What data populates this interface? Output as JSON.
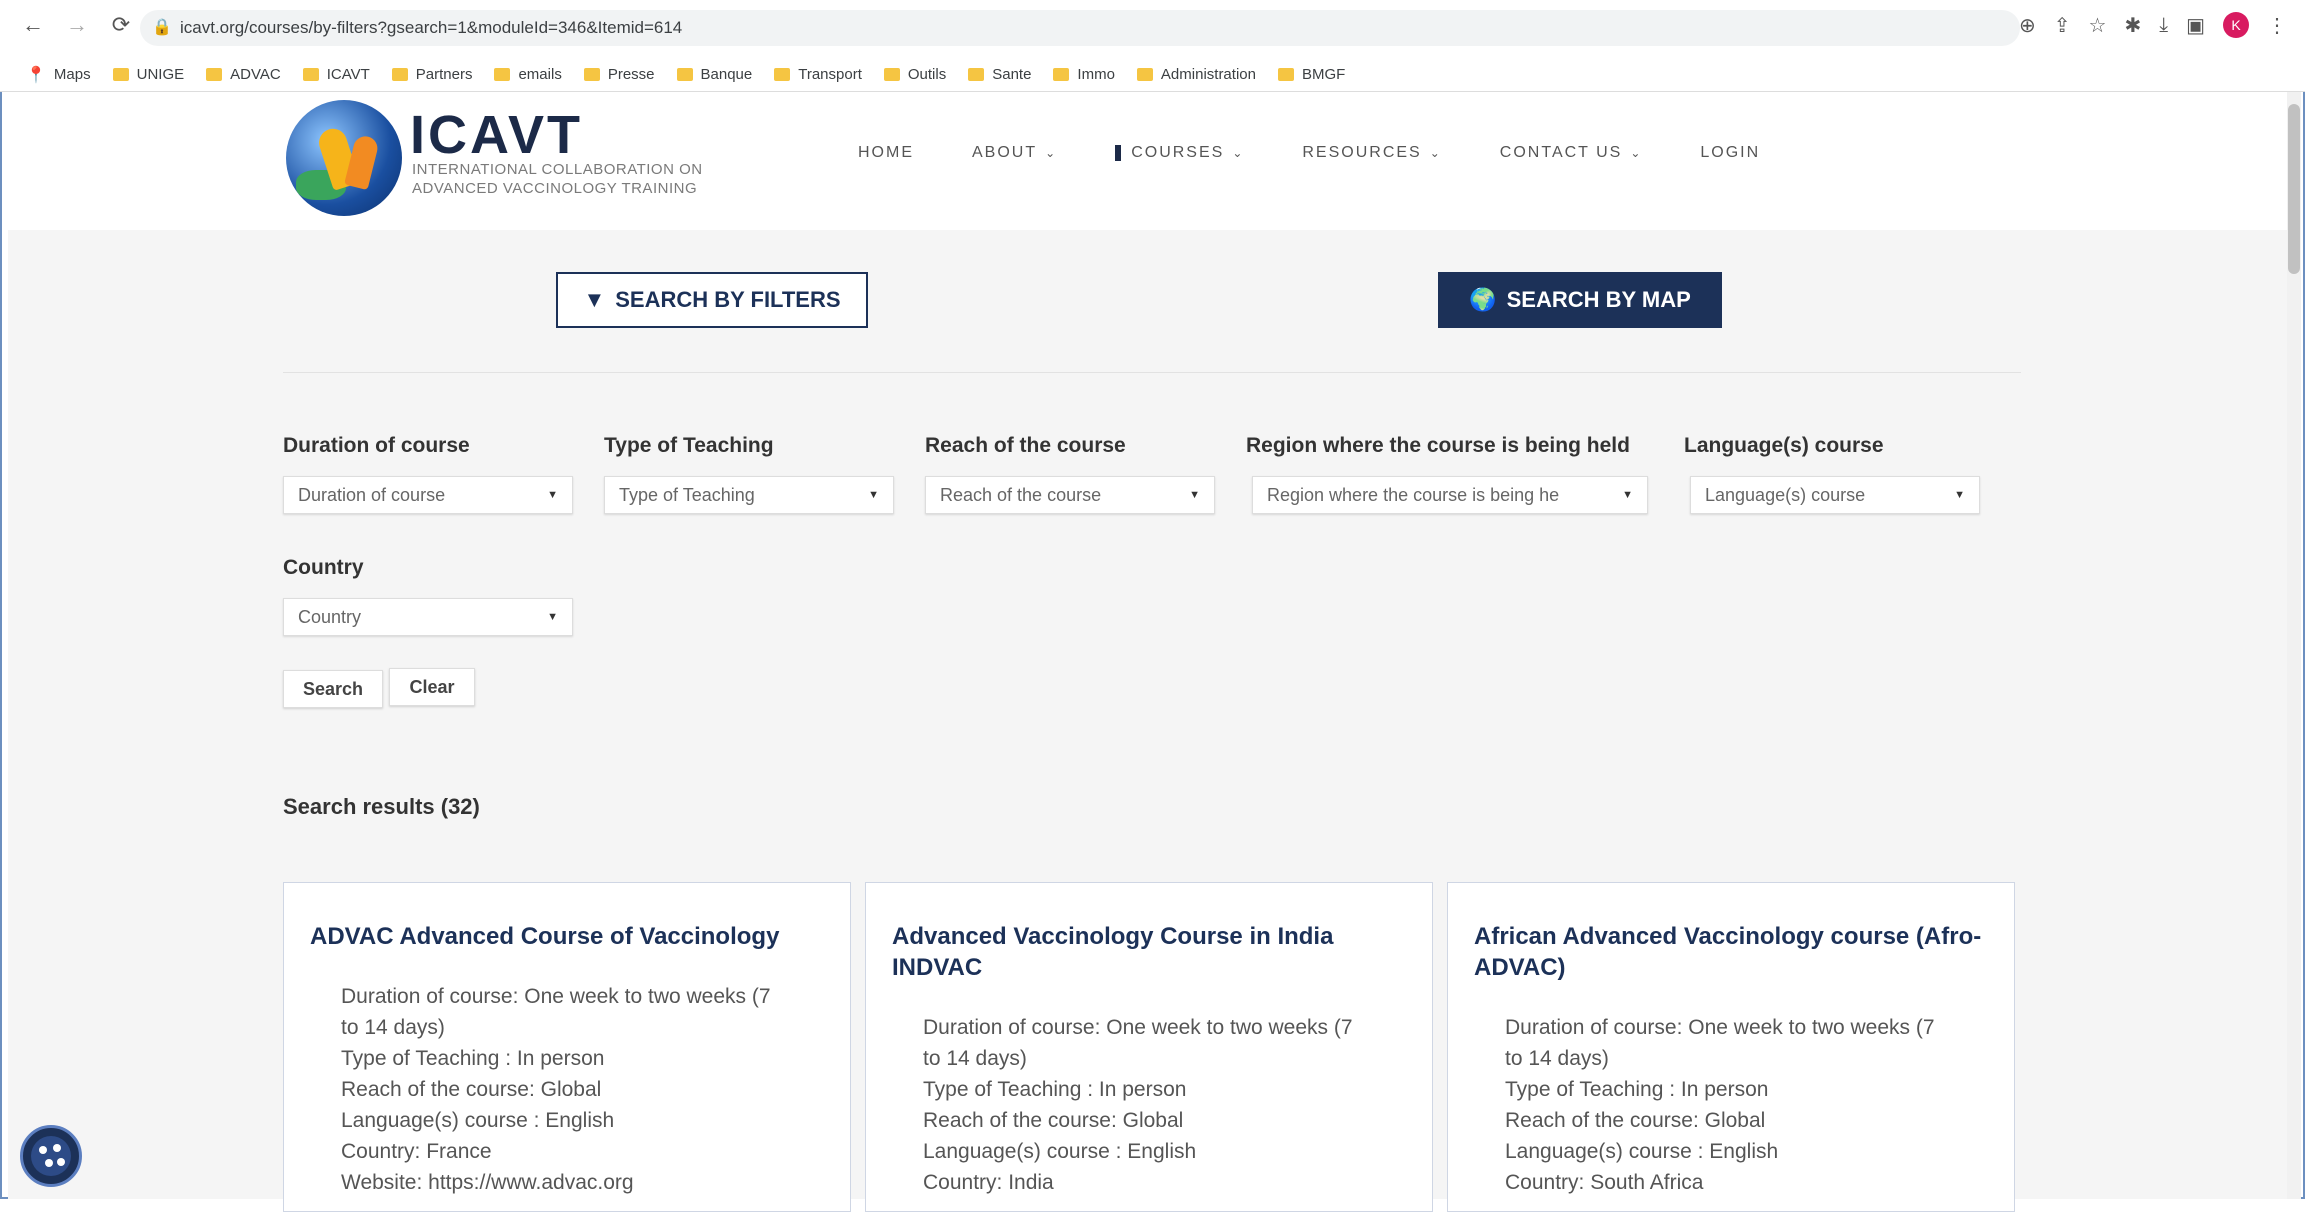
{
  "browser": {
    "url": "icavt.org/courses/by-filters?gsearch=1&moduleId=346&Itemid=614",
    "avatar_letter": "K",
    "bookmarks": [
      "Maps",
      "UNIGE",
      "ADVAC",
      "ICAVT",
      "Partners",
      "emails",
      "Presse",
      "Banque",
      "Transport",
      "Outils",
      "Sante",
      "Immo",
      "Administration",
      "BMGF"
    ]
  },
  "site": {
    "brand": "ICAVT",
    "brand_sub_line1": "INTERNATIONAL COLLABORATION ON",
    "brand_sub_line2": "ADVANCED VACCINOLOGY TRAINING",
    "nav": {
      "home": "HOME",
      "about": "ABOUT",
      "courses": "COURSES",
      "resources": "RESOURCES",
      "contact": "CONTACT US",
      "login": "LOGIN"
    }
  },
  "search_tabs": {
    "filters": "SEARCH BY FILTERS",
    "map": "SEARCH BY MAP"
  },
  "filters": {
    "duration": {
      "label": "Duration of course",
      "value": "Duration of course"
    },
    "teaching": {
      "label": "Type of Teaching",
      "value": "Type of Teaching"
    },
    "reach": {
      "label": "Reach of the course",
      "value": "Reach of the course"
    },
    "region": {
      "label": "Region where the course is being held",
      "value": "Region where the course is being he"
    },
    "language": {
      "label": "Language(s) course",
      "value": "Language(s) course"
    },
    "country": {
      "label": "Country",
      "value": "Country"
    }
  },
  "actions": {
    "search": "Search",
    "clear": "Clear"
  },
  "results": {
    "title": "Search results (32)",
    "cards": [
      {
        "title": "ADVAC Advanced Course of Vaccinology",
        "lines": [
          "Duration of course: One week to two weeks (7",
          "to 14 days)",
          "Type of Teaching : In person",
          "Reach of the course: Global",
          "Language(s) course : English",
          "Country: France",
          "Website: https://www.advac.org"
        ]
      },
      {
        "title": "Advanced Vaccinology Course in India INDVAC",
        "lines": [
          "Duration of course: One week to two weeks (7",
          "to 14 days)",
          "Type of Teaching : In person",
          "Reach of the course: Global",
          "Language(s) course : English",
          "Country: India"
        ]
      },
      {
        "title": "African Advanced Vaccinology course (Afro-ADVAC)",
        "lines": [
          "Duration of course: One week to two weeks (7",
          "to 14 days)",
          "Type of Teaching : In person",
          "Reach of the course: Global",
          "Language(s) course : English",
          "Country: South Africa"
        ]
      }
    ]
  }
}
